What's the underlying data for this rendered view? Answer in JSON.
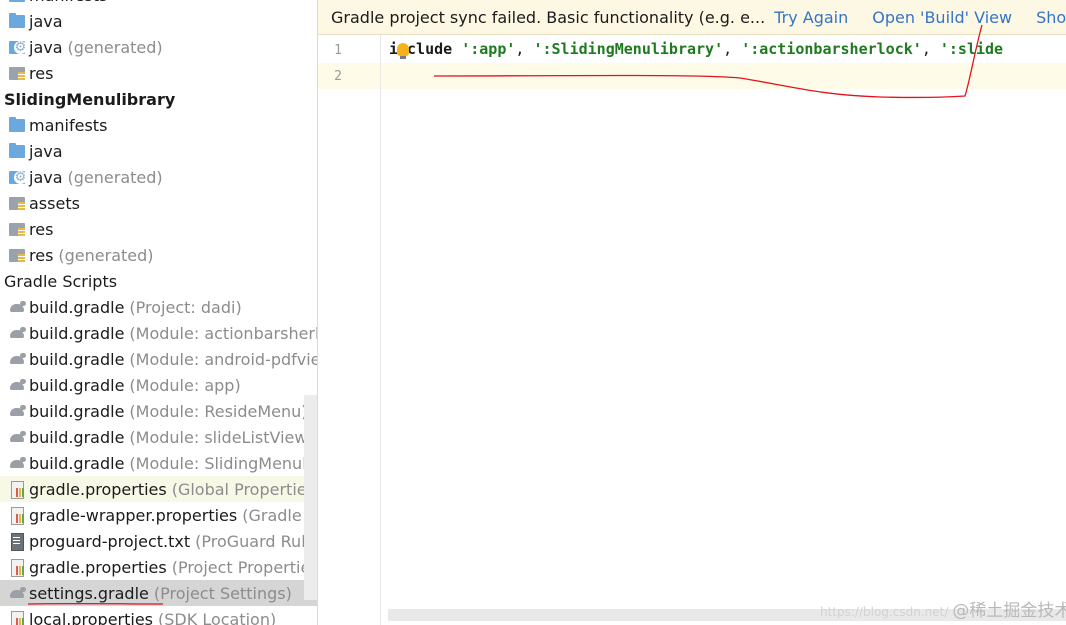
{
  "project_tree": {
    "items": [
      {
        "label": "manifests",
        "suffix": "",
        "icon": "folder-blue"
      },
      {
        "label": "java",
        "suffix": "",
        "icon": "folder-blue"
      },
      {
        "label": "java",
        "suffix": "(generated)",
        "icon": "folder-gen"
      },
      {
        "label": "res",
        "suffix": "",
        "icon": "folder-res"
      },
      {
        "label": "SlidingMenulibrary",
        "suffix": "",
        "icon": ""
      },
      {
        "label": "manifests",
        "suffix": "",
        "icon": "folder-blue"
      },
      {
        "label": "java",
        "suffix": "",
        "icon": "folder-blue"
      },
      {
        "label": "java",
        "suffix": "(generated)",
        "icon": "folder-gen"
      },
      {
        "label": "assets",
        "suffix": "",
        "icon": "folder-res"
      },
      {
        "label": "res",
        "suffix": "",
        "icon": "folder-res"
      },
      {
        "label": "res",
        "suffix": "(generated)",
        "icon": "folder-res"
      },
      {
        "label": "Gradle Scripts",
        "suffix": "",
        "icon": ""
      },
      {
        "label": "build.gradle",
        "suffix": "(Project: dadi)",
        "icon": "gradle-gray"
      },
      {
        "label": "build.gradle",
        "suffix": "(Module: actionbarsherlo",
        "icon": "gradle-gray"
      },
      {
        "label": "build.gradle",
        "suffix": "(Module: android-pdfview",
        "icon": "gradle-gray"
      },
      {
        "label": "build.gradle",
        "suffix": "(Module: app)",
        "icon": "gradle-gray"
      },
      {
        "label": "build.gradle",
        "suffix": "(Module: ResideMenu)",
        "icon": "gradle-gray"
      },
      {
        "label": "build.gradle",
        "suffix": "(Module: slideListViewlibr",
        "icon": "gradle-gray"
      },
      {
        "label": "build.gradle",
        "suffix": "(Module: SlidingMenulibr",
        "icon": "gradle-gray"
      },
      {
        "label": "gradle.properties",
        "suffix": "(Global Properties)",
        "icon": "props-file"
      },
      {
        "label": "gradle-wrapper.properties",
        "suffix": "(Gradle Ver",
        "icon": "props-file"
      },
      {
        "label": "proguard-project.txt",
        "suffix": "(ProGuard Rules",
        "icon": "txt-file"
      },
      {
        "label": "gradle.properties",
        "suffix": "(Project Properties)",
        "icon": "props-file"
      },
      {
        "label": "settings.gradle",
        "suffix": "(Project Settings)",
        "icon": "gradle-gray"
      },
      {
        "label": "local.properties",
        "suffix": "(SDK Location)",
        "icon": "props-file"
      }
    ]
  },
  "banner": {
    "message": "Gradle project sync failed. Basic functionality (e.g. e...",
    "try_again": "Try Again",
    "open_build": "Open 'Build' View",
    "show_log": "Show Log"
  },
  "editor": {
    "line_numbers": [
      "1",
      "2"
    ],
    "line1": {
      "kw_a": "i",
      "kw_b": "clude",
      "s1": "':app'",
      "s2": "':SlidingMenulibrary'",
      "s3": "':actionbarsherlock'",
      "s4": "':slide"
    },
    "separator": ", "
  },
  "watermark": {
    "url": "https://blog.csdn.net/",
    "text": "@稀土掘金技术社区"
  },
  "colors": {
    "banner_bg": "#fdf8e3",
    "link": "#3574c9",
    "string": "#1f7a1f",
    "annotation": "#e0141c",
    "selected_row": "#d5d5d5",
    "highlight_row": "#f8f8e6"
  }
}
